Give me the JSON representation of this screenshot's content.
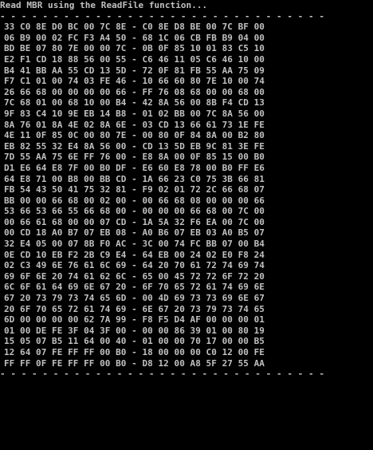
{
  "console": {
    "title": "Read MBR using the ReadFile function...",
    "separator_top": "- - - - - - - - - - - - - - - - - - - - - - - - - - - - - - -",
    "rows": [
      "33 C0 8E D0 BC 00 7C 8E - C0 8E D8 BE 00 7C BF 00",
      "06 B9 00 02 FC F3 A4 50 - 68 1C 06 CB FB B9 04 00",
      "BD BE 07 80 7E 00 00 7C - 0B 0F 85 10 01 83 C5 10",
      "E2 F1 CD 18 88 56 00 55 - C6 46 11 05 C6 46 10 00",
      "B4 41 BB AA 55 CD 13 5D - 72 0F 81 FB 55 AA 75 09",
      "F7 C1 01 00 74 03 FE 46 - 10 66 60 80 7E 10 00 74",
      "26 66 68 00 00 00 00 66 - FF 76 08 68 00 00 68 00",
      "7C 68 01 00 68 10 00 B4 - 42 8A 56 00 8B F4 CD 13",
      "9F 83 C4 10 9E EB 14 B8 - 01 02 BB 00 7C 8A 56 00",
      "8A 76 01 8A 4E 02 8A 6E - 03 CD 13 66 61 73 1E FE",
      "4E 11 0F 85 0C 00 80 7E - 00 80 0F 84 8A 00 B2 80",
      "EB 82 55 32 E4 8A 56 00 - CD 13 5D EB 9C 81 3E FE",
      "7D 55 AA 75 6E FF 76 00 - E8 8A 00 0F 85 15 00 B0",
      "D1 E6 64 E8 7F 00 B0 DF - E6 60 E8 78 00 B0 FF E6",
      "64 E8 71 00 B8 00 BB CD - 1A 66 23 C0 75 3B 66 81",
      "FB 54 43 50 41 75 32 81 - F9 02 01 72 2C 66 68 07",
      "BB 00 00 66 68 00 02 00 - 00 66 68 08 00 00 00 66",
      "53 66 53 66 55 66 68 00 - 00 00 00 66 68 00 7C 00",
      "00 66 61 68 00 00 07 CD - 1A 5A 32 F6 EA 00 7C 00",
      "00 CD 18 A0 B7 07 EB 08 - A0 B6 07 EB 03 A0 B5 07",
      "32 E4 05 00 07 8B F0 AC - 3C 00 74 FC BB 07 00 B4",
      "0E CD 10 EB F2 2B C9 E4 - 64 EB 00 24 02 E0 F8 24",
      "02 C3 49 6E 76 61 6C 69 - 64 20 70 61 72 74 69 74",
      "69 6F 6E 20 74 61 62 6C - 65 00 45 72 72 6F 72 20",
      "6C 6F 61 64 69 6E 67 20 - 6F 70 65 72 61 74 69 6E",
      "67 20 73 79 73 74 65 6D - 00 4D 69 73 73 69 6E 67",
      "20 6F 70 65 72 61 74 69 - 6E 67 20 73 79 73 74 65",
      "6D 00 00 00 00 62 7A 99 - F8 F5 D4 AF 00 00 00 01",
      "01 00 DE FE 3F 04 3F 00 - 00 00 86 39 01 00 80 19",
      "15 05 07 B5 11 64 00 40 - 01 00 00 70 17 00 00 B5",
      "12 64 07 FE FF FF 00 B0 - 18 00 00 00 C0 12 00 FE",
      "FF FF 0F FE FF FF 00 B0 - D8 12 00 A8 5F 27 55 AA"
    ],
    "separator_bottom": "- - - - - - - - - - - - - - - - - - - - - - - - - - - - - - -"
  },
  "colors": {
    "background": "#000000",
    "text": "#c0c0c0"
  }
}
